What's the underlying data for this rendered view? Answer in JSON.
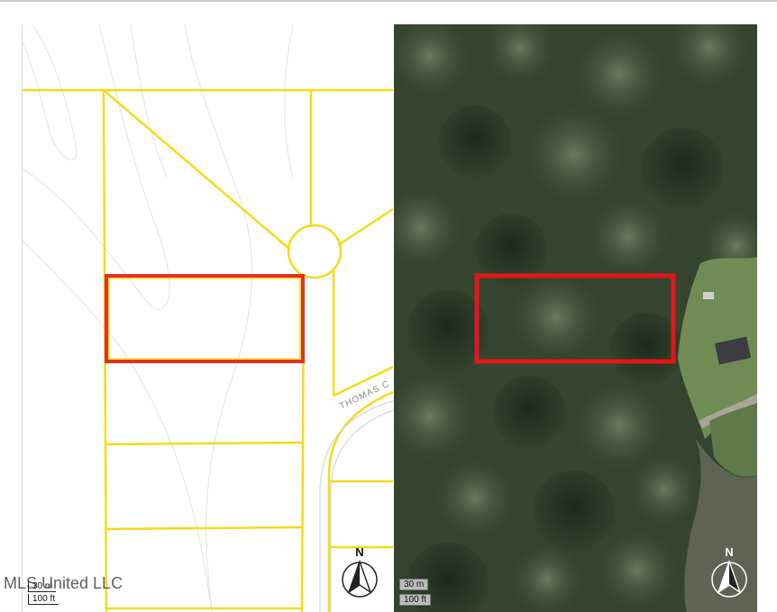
{
  "parcel_map": {
    "street_label": "THOMAS C",
    "scale": {
      "meters": "30 m",
      "feet": "100 ft"
    },
    "north": "N"
  },
  "aerial_map": {
    "scale": {
      "meters": "30 m",
      "feet": "100 ft"
    },
    "north": "N"
  },
  "watermark": "MLS United LLC",
  "colors": {
    "parcel_line": "#f2dc1a",
    "highlight": "#e21f1f",
    "contour": "#e6e6e6"
  }
}
